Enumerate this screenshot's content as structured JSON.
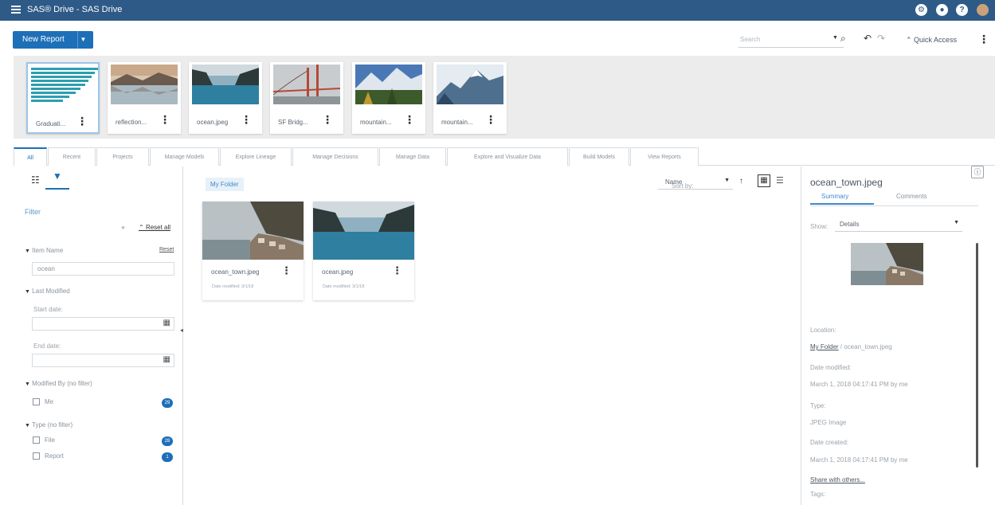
{
  "app": {
    "title": "SAS® Drive - SAS Drive"
  },
  "header_icons": [
    "settings-icon",
    "user-icon",
    "help-icon",
    "avatar"
  ],
  "toolbar": {
    "new_report_label": "New Report",
    "search_placeholder": "Search",
    "quick_access_label": "Quick Access"
  },
  "recents": [
    {
      "label": "Graduati...",
      "thumb": "bar-chart-thumbnail"
    },
    {
      "label": "reflection...",
      "thumb": "lake-reflection-thumbnail"
    },
    {
      "label": "ocean.jpeg",
      "thumb": "fjord-thumbnail"
    },
    {
      "label": "SF Bridg...",
      "thumb": "bridge-thumbnail"
    },
    {
      "label": "mountain...",
      "thumb": "mountain-thumbnail"
    },
    {
      "label": "mountain...",
      "thumb": "snowy-mountain-thumbnail"
    }
  ],
  "tabs": [
    "All",
    "Recent",
    "Projects",
    "Manage Models",
    "Explore Lineage",
    "Manage Decisions",
    "Manage Data",
    "Explore and Visualize Data",
    "Build Models",
    "View Reports"
  ],
  "filter": {
    "heading": "Filter",
    "reset_all": "Reset all",
    "item_name_label": "Item Name",
    "item_name_reset": "Reset",
    "item_name_value": "ocean",
    "last_modified_label": "Last Modified",
    "start_date_label": "Start date:",
    "end_date_label": "End date:",
    "modified_by_label": "Modified By (no filter)",
    "modified_by_me": "Me",
    "modified_by_me_count": "29",
    "type_label": "Type (no filter)",
    "type_file": "File",
    "type_file_count": "28",
    "type_report": "Report",
    "type_report_count": "1"
  },
  "main": {
    "breadcrumb": "My Folder",
    "sort_label": "Sort by:",
    "sort_value": "Name",
    "files": [
      {
        "name": "ocean_town.jpeg",
        "modified_label": "Date modified:",
        "modified": "3/1/18"
      },
      {
        "name": "ocean.jpeg",
        "modified_label": "Date modified:",
        "modified": "3/1/18"
      }
    ]
  },
  "details": {
    "title": "ocean_town.jpeg",
    "tab_summary": "Summary",
    "tab_comments": "Comments",
    "show_label": "Show:",
    "show_value": "Details",
    "location_label": "Location:",
    "location_link": "My Folder",
    "location_rest": " / ocean_town.jpeg",
    "date_modified_label": "Date modified:",
    "date_modified_value": "March 1, 2018 04:17:41 PM by me",
    "type_label": "Type:",
    "type_value": "JPEG Image",
    "date_created_label": "Date created:",
    "date_created_value": "March 1, 2018 04:17:41 PM by me",
    "share_link": "Share with others...",
    "tags_label": "Tags:"
  },
  "colors": {
    "header": "#2e5a87",
    "accent": "#1d6fb8",
    "link": "#3f8acb"
  }
}
